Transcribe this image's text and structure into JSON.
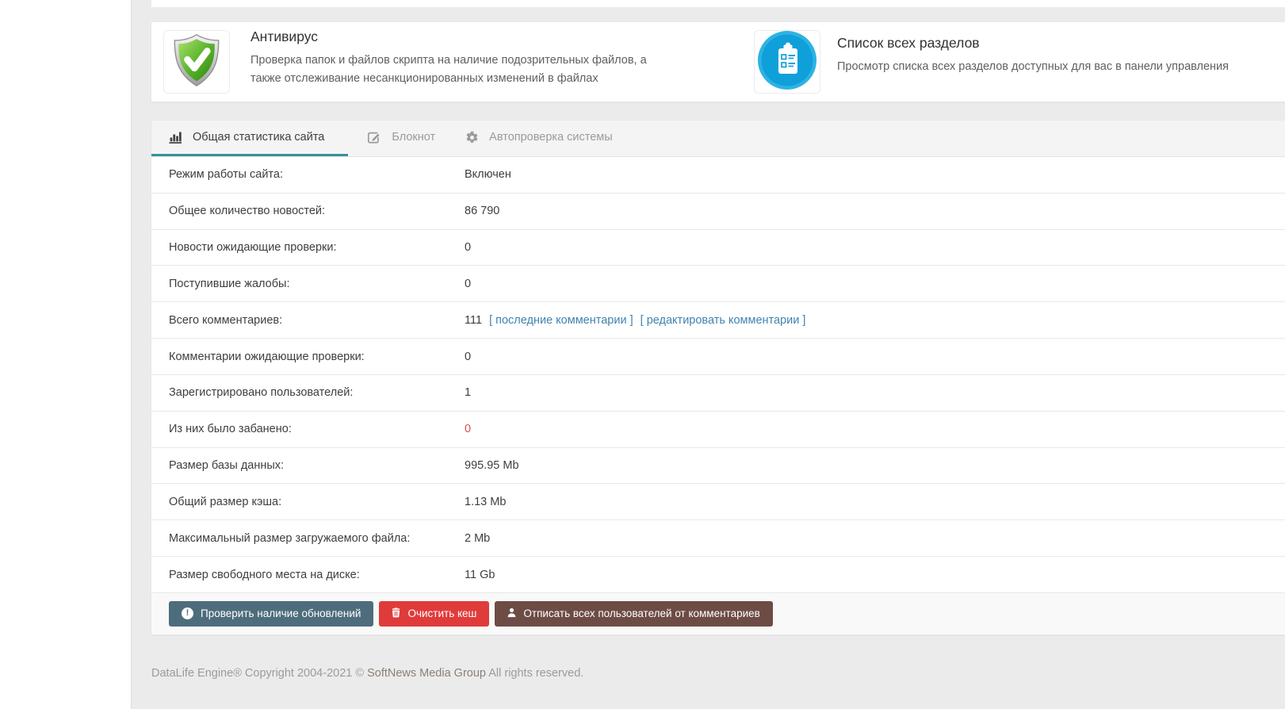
{
  "cards": [
    {
      "title": "Антивирус",
      "description": "Проверка папок и файлов скрипта на наличие подозрительных файлов, а также отслеживание несанкционированных изменений в файлах",
      "icon": "shield-check-icon"
    },
    {
      "title": "Список всех разделов",
      "description": "Просмотр списка всех разделов доступных для вас в панели управления",
      "icon": "clipboard-list-icon"
    }
  ],
  "tabs": [
    {
      "label": "Общая статистика сайта",
      "icon": "bar-chart-icon",
      "active": true
    },
    {
      "label": "Блокнот",
      "icon": "notepad-edit-icon",
      "active": false
    },
    {
      "label": "Автопроверка системы",
      "icon": "gear-icon",
      "active": false
    }
  ],
  "stats": {
    "rows": [
      {
        "label": "Режим работы сайта:",
        "value": "Включен"
      },
      {
        "label": "Общее количество новостей:",
        "value": "86 790"
      },
      {
        "label": "Новости ожидающие проверки:",
        "value": "0"
      },
      {
        "label": "Поступившие жалобы:",
        "value": "0"
      },
      {
        "label": "Всего комментариев:",
        "value": "111",
        "links": [
          "[ последние комментарии ]",
          "[ редактировать комментарии ]"
        ]
      },
      {
        "label": "Комментарии ожидающие проверки:",
        "value": "0"
      },
      {
        "label": "Зарегистрировано пользователей:",
        "value": "1"
      },
      {
        "label": "Из них было забанено:",
        "value": "0",
        "highlight": "danger"
      },
      {
        "label": "Размер базы данных:",
        "value": "995.95 Mb"
      },
      {
        "label": "Общий размер кэша:",
        "value": "1.13 Mb"
      },
      {
        "label": "Максимальный размер загружаемого файла:",
        "value": "2 Mb"
      },
      {
        "label": "Размер свободного места на диске:",
        "value": "11 Gb"
      }
    ]
  },
  "buttons": [
    {
      "label": "Проверить наличие обновлений",
      "icon": "exclamation-circle-icon",
      "color": "#4e6d7c"
    },
    {
      "label": "Очистить кеш",
      "icon": "trash-icon",
      "color": "#e03b3b"
    },
    {
      "label": "Отписать всех пользователей от комментариев",
      "icon": "user-icon",
      "color": "#6d4c45"
    }
  ],
  "footer": {
    "brand": "DataLife Engine",
    "reg": "®",
    "copyright": "Copyright 2004-2021 ©",
    "company": "SoftNews Media Group",
    "rights": "All rights reserved."
  },
  "colors": {
    "accent_teal": "#38919e",
    "link_blue": "#4183af",
    "danger_red": "#e04c4c",
    "icon_blue": "#0fa0da",
    "shield_green": "#46a317",
    "content_bg": "#ebebeb"
  }
}
